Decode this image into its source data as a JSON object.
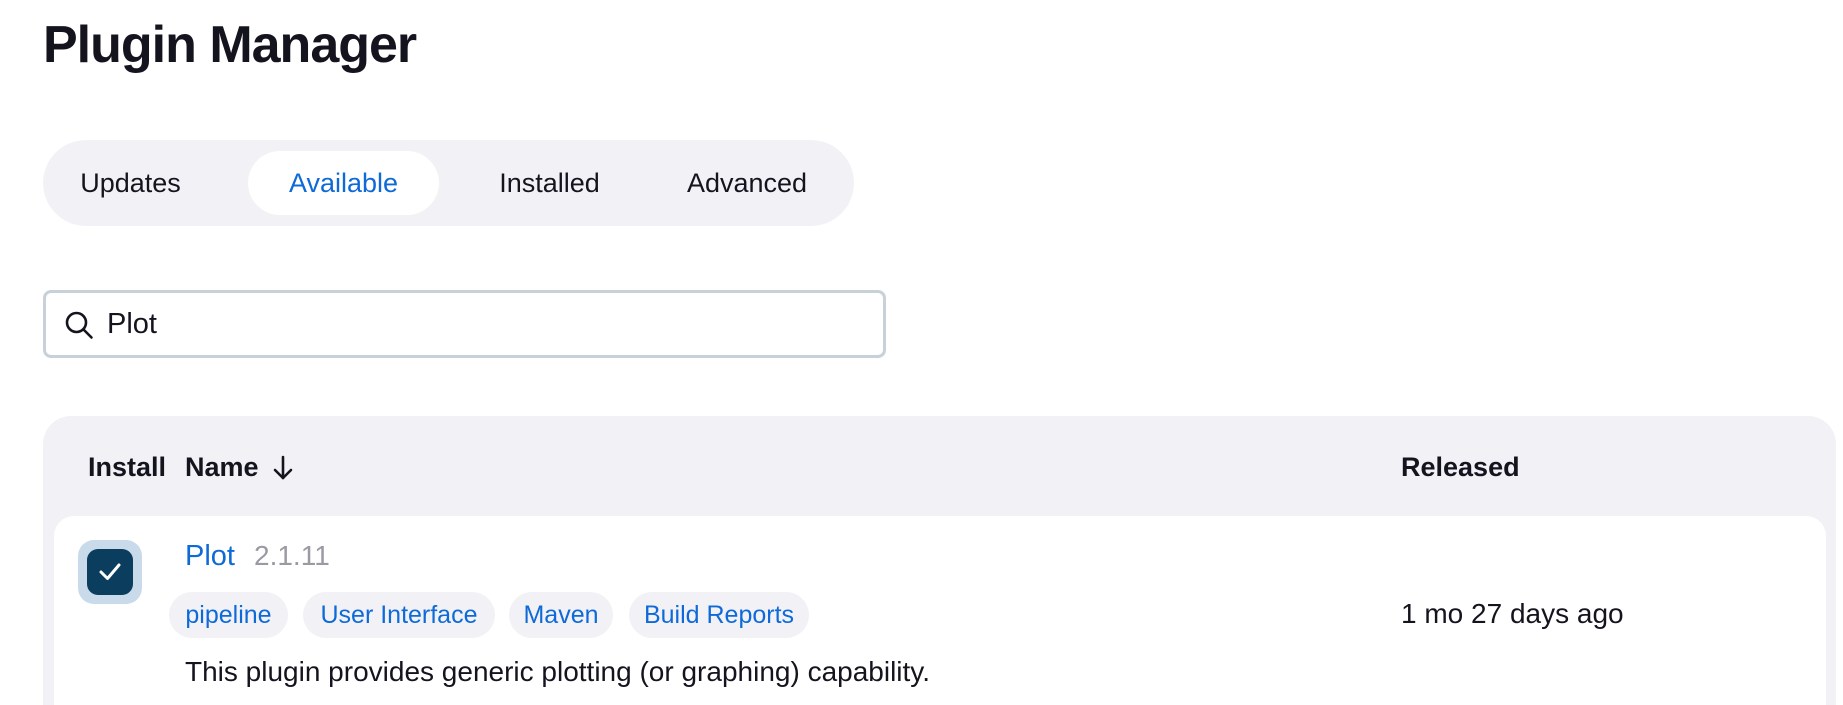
{
  "page": {
    "title": "Plugin Manager"
  },
  "tabs": [
    {
      "label": "Updates",
      "active": false
    },
    {
      "label": "Available",
      "active": true
    },
    {
      "label": "Installed",
      "active": false
    },
    {
      "label": "Advanced",
      "active": false
    }
  ],
  "search": {
    "value": "Plot",
    "icon": "search-icon"
  },
  "table": {
    "headers": {
      "install": "Install",
      "name": "Name",
      "released": "Released"
    },
    "sort_icon": "arrow-down-icon",
    "rows": [
      {
        "checked": true,
        "name": "Plot",
        "version": "2.1.11",
        "tags": [
          "pipeline",
          "User Interface",
          "Maven",
          "Build Reports"
        ],
        "released": "1 mo 27 days ago",
        "description": "This plugin provides generic plotting (or graphing) capability."
      }
    ]
  },
  "colors": {
    "accent": "#0e6ad8",
    "checkbox": "#0b3d5e",
    "panel": "#f2f2f6"
  }
}
